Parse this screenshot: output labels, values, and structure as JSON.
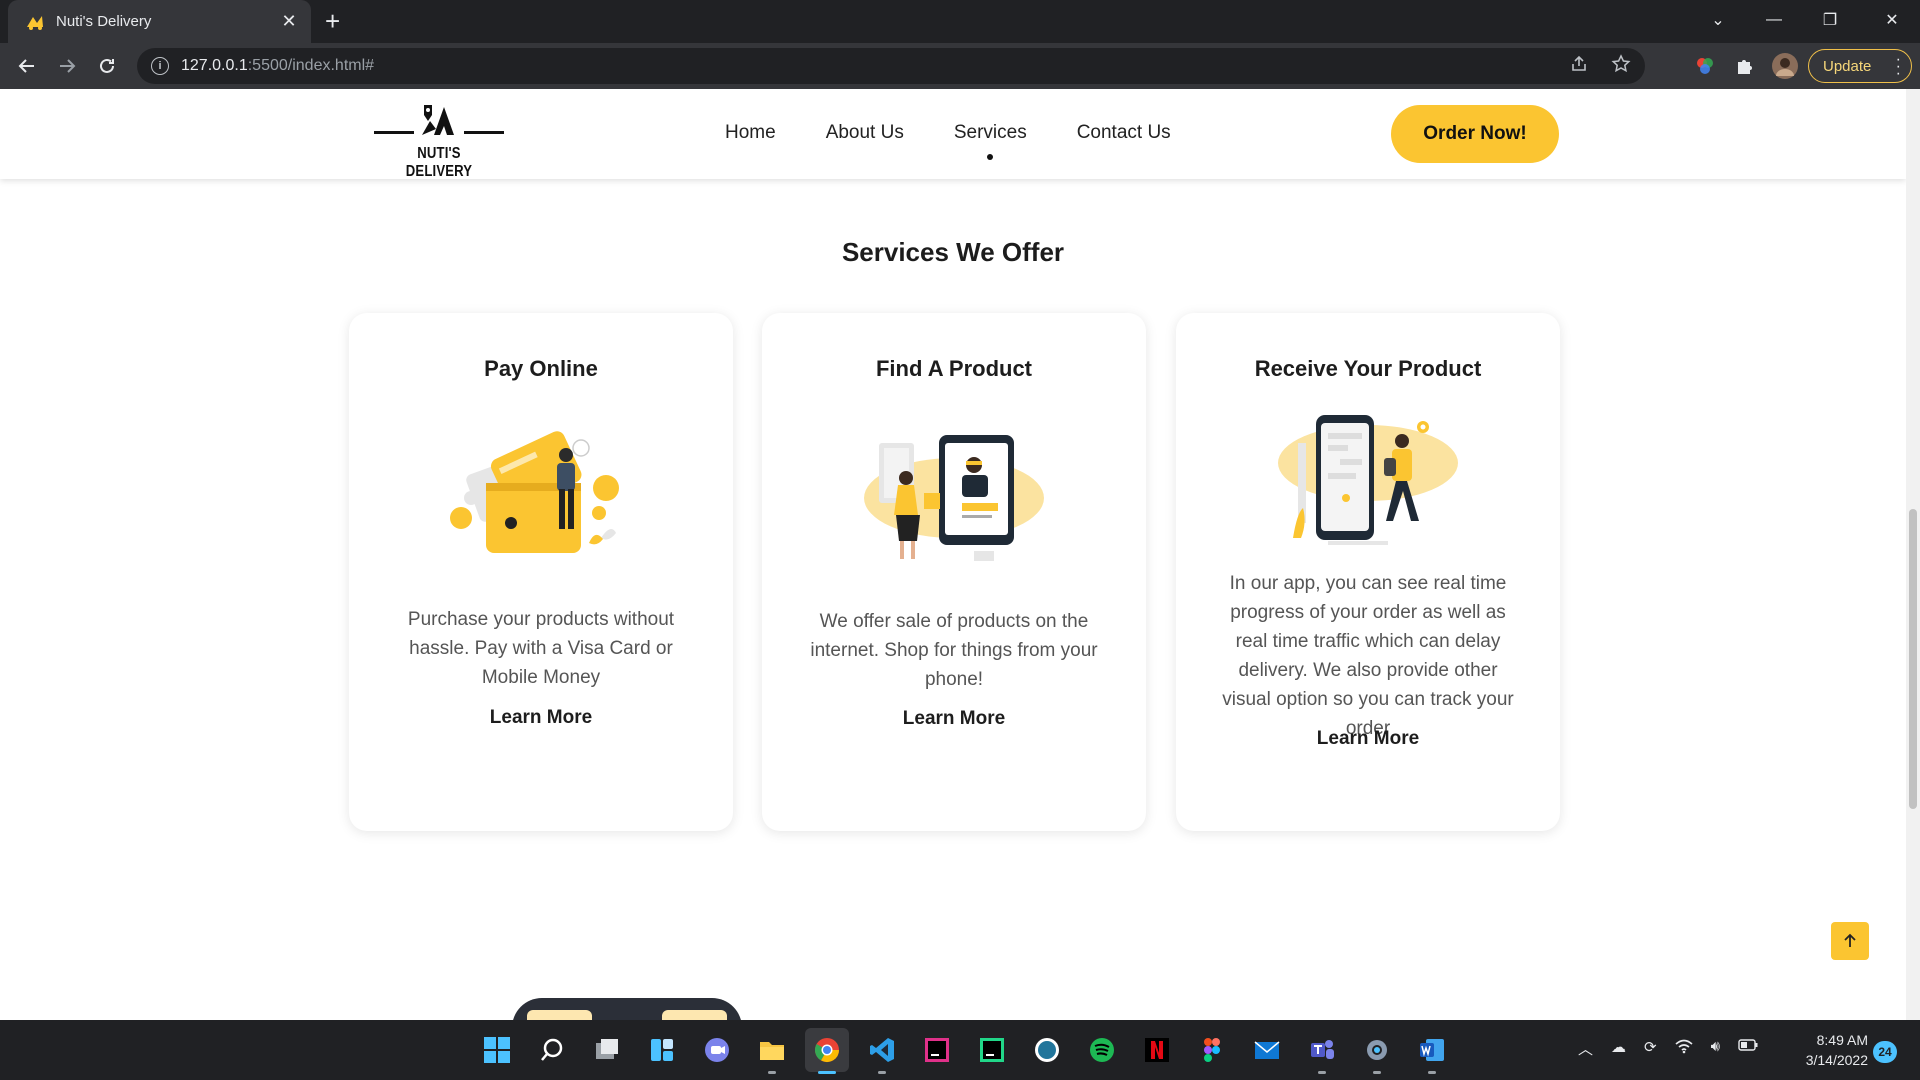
{
  "browser": {
    "tab_title": "Nuti's Delivery",
    "url_host": "127.0.0.1",
    "url_rest": ":5500/index.html#",
    "update_label": "Update"
  },
  "site": {
    "logo_text": "NUTI'S DELIVERY",
    "nav": [
      "Home",
      "About Us",
      "Services",
      "Contact Us"
    ],
    "active_nav": "Services",
    "cta": "Order Now!",
    "brand_color": "#fbc531"
  },
  "services": {
    "title": "Services We Offer",
    "cards": [
      {
        "title": "Pay Online",
        "text": "Purchase your products without hassle. Pay with a Visa Card or Mobile Money",
        "link": "Learn More",
        "illustration": "wallet-payment-illustration"
      },
      {
        "title": "Find A Product",
        "text": "We offer sale of products on the internet. Shop for things from your phone!",
        "link": "Learn More",
        "illustration": "online-shopping-illustration"
      },
      {
        "title": "Receive Your Product",
        "text": "In our app, you can see real time progress of your order as well as real time traffic which can delay delivery. We also provide other visual option so you can track your order",
        "link": "Learn More",
        "illustration": "delivery-tracking-illustration"
      }
    ]
  },
  "taskbar": {
    "time": "8:49 AM",
    "date": "3/14/2022",
    "notifications": "24"
  }
}
